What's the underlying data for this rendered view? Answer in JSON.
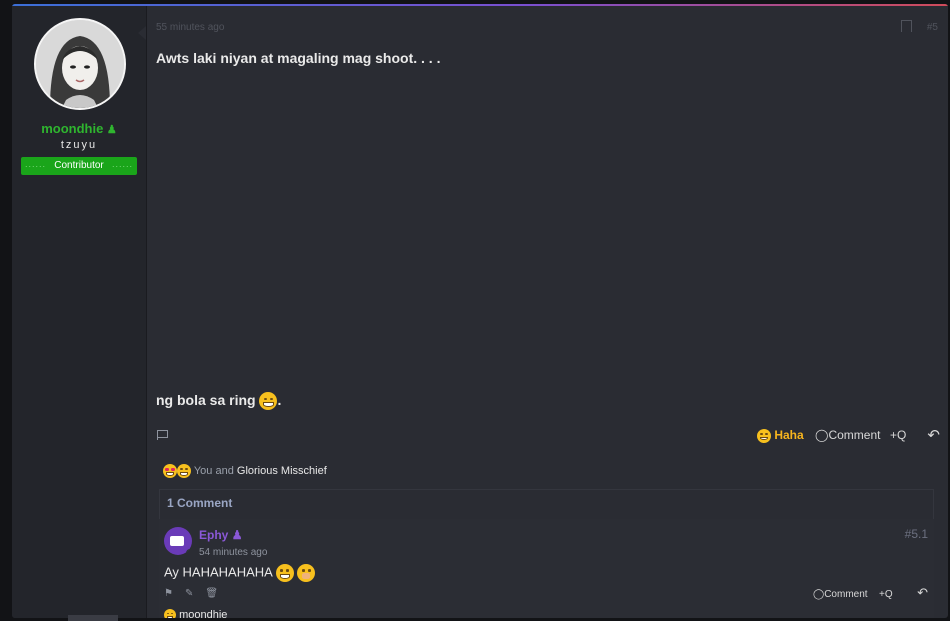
{
  "author": {
    "username": "moondhie",
    "user_title": "tzuyu",
    "rank": "Contributor",
    "name_icon": "user-badge-icon"
  },
  "post": {
    "time": "55 minutes ago",
    "number": "#5",
    "line1": "Awts laki niyan at magaling mag shoot. . . .",
    "line2": "ng bola sa ring",
    "line2_suffix": ".",
    "actions": {
      "haha": "Haha",
      "comment": "Comment",
      "quote": "+Q"
    },
    "reactions_prefix": "You and",
    "reactions_names": "Glorious Misschief"
  },
  "comments": {
    "count_label": "1 Comment",
    "items": [
      {
        "author": "Ephy",
        "time": "54 minutes ago",
        "number": "#5.1",
        "text": "Ay HAHAHAHAHA",
        "actions": {
          "comment": "Comment",
          "quote": "+Q"
        },
        "reaction_user": "moondhie"
      }
    ]
  },
  "colors": {
    "accent_green": "#2fb52f",
    "haha_yellow": "#f7b51e",
    "ephy_purple": "#8a58d6"
  }
}
